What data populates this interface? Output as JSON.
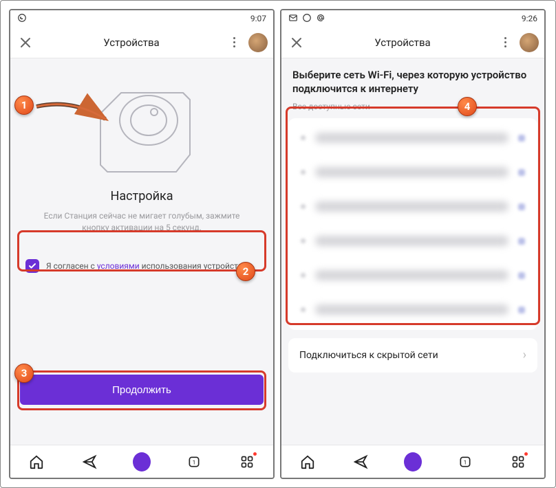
{
  "left": {
    "status": {
      "time": "9:07"
    },
    "header": {
      "title": "Устройства"
    },
    "setup": {
      "title": "Настройка",
      "desc": "Если Станция сейчас не мигает голубым, зажмите кнопку активации на 5 секунд."
    },
    "terms": {
      "prefix": "Я согласен с ",
      "link": "условиями",
      "suffix": " использования устройства"
    },
    "continue": "Продолжить"
  },
  "right": {
    "status": {
      "time": "9:26"
    },
    "header": {
      "title": "Устройства"
    },
    "wifi": {
      "heading": "Выберите сеть Wi-Fi, через которую устройство подключится к интернету",
      "subheading": "Все доступные сети",
      "hidden": "Подключиться к скрытой сети"
    }
  },
  "callouts": {
    "c1": "1",
    "c2": "2",
    "c3": "3",
    "c4": "4"
  },
  "colors": {
    "accent": "#6b2fd6",
    "calloutBorder": "#d63a2a"
  }
}
